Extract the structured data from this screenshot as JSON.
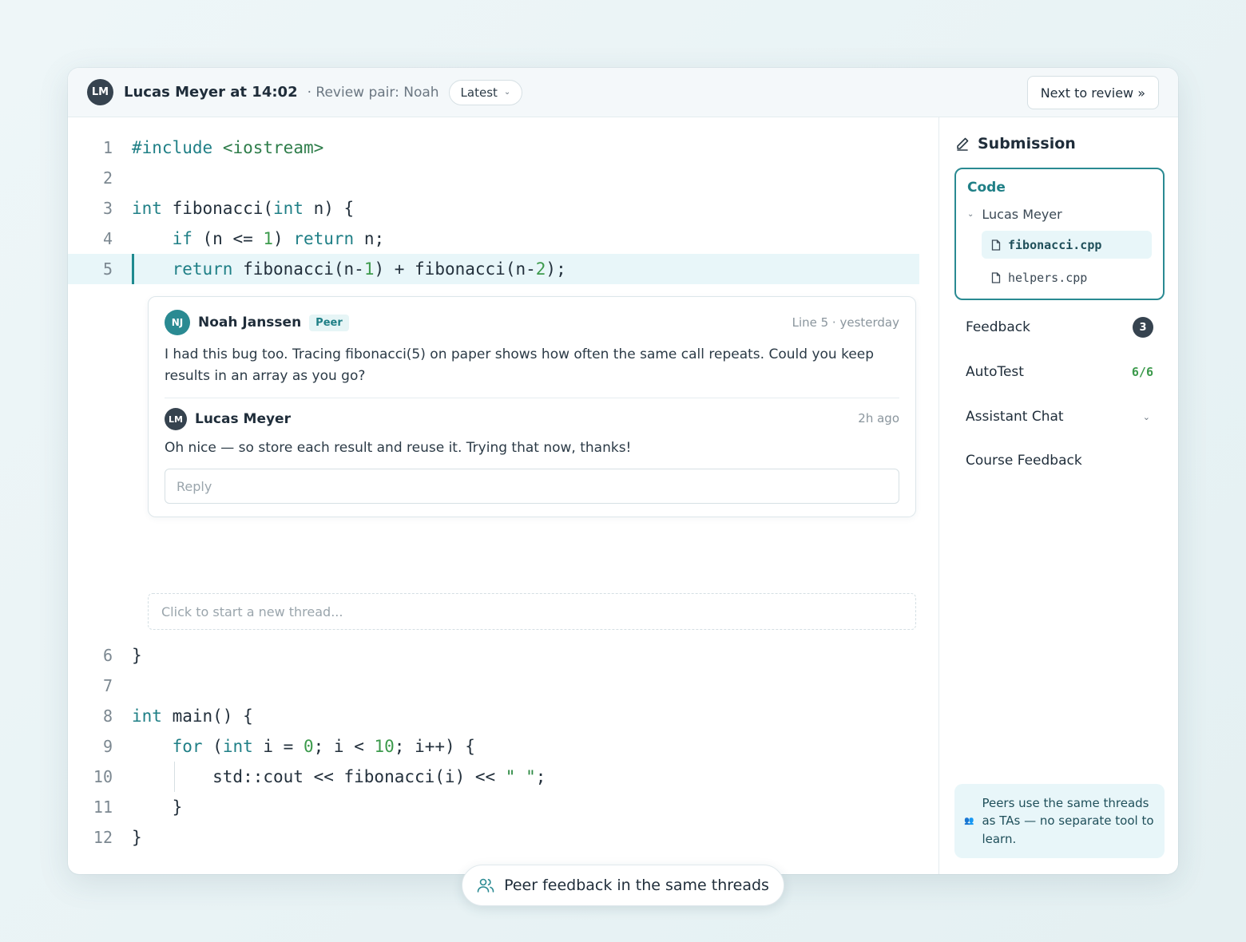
{
  "header": {
    "avatar_initials": "LM",
    "author_time": "Lucas Meyer at 14:02",
    "review_pair": "· Review pair: Noah",
    "version_label": "Latest",
    "next_button": "Next to review »"
  },
  "code": {
    "lines": [
      {
        "n": "1",
        "text": "#include <iostream>"
      },
      {
        "n": "2",
        "text": ""
      },
      {
        "n": "3",
        "text": "int fibonacci(int n) {"
      },
      {
        "n": "4",
        "text": "    if (n <= 1) return n;"
      },
      {
        "n": "5",
        "text": "    return fibonacci(n-1) + fibonacci(n-2);",
        "highlighted": true
      },
      {
        "n": "6",
        "text": "}"
      },
      {
        "n": "7",
        "text": ""
      },
      {
        "n": "8",
        "text": "int main() {"
      },
      {
        "n": "9",
        "text": "    for (int i = 0; i < 10; i++) {"
      },
      {
        "n": "10",
        "text": "        std::cout << fibonacci(i) << \" \";"
      },
      {
        "n": "11",
        "text": "    }"
      },
      {
        "n": "12",
        "text": "}"
      }
    ]
  },
  "thread": {
    "comment": {
      "initials": "NJ",
      "author": "Noah Janssen",
      "badge": "Peer",
      "meta": "Line 5 · yesterday",
      "text": "I had this bug too. Tracing fibonacci(5) on paper shows how often the same call repeats. Could you keep results in an array as you go?"
    },
    "reply_comment": {
      "initials": "LM",
      "author": "Lucas Meyer",
      "meta": "2h ago",
      "text": "Oh nice — so store each result and reuse it. Trying that now, thanks!"
    },
    "reply_placeholder": "Reply",
    "new_thread": "Click to start a new thread..."
  },
  "sidebar": {
    "title": "Submission",
    "code_label": "Code",
    "tree_user": "Lucas Meyer",
    "files": [
      {
        "name": "fibonacci.cpp",
        "active": true
      },
      {
        "name": "helpers.cpp",
        "active": false
      }
    ],
    "nav": {
      "feedback": {
        "label": "Feedback",
        "count": "3"
      },
      "autotest": {
        "label": "AutoTest",
        "score": "6/6"
      },
      "assistant": {
        "label": "Assistant Chat"
      },
      "course": {
        "label": "Course Feedback"
      }
    },
    "tip": "Peers use the same threads as TAs — no separate tool to learn."
  },
  "pill": {
    "icon": "users-icon",
    "text": "Peer feedback in the same threads"
  },
  "colors": {
    "accent": "#2a8a92",
    "highlight_bg": "#e8f6f9",
    "keyword": "#1f7f86",
    "number": "#3c9a4c",
    "avatar_dark": "#36434f"
  }
}
